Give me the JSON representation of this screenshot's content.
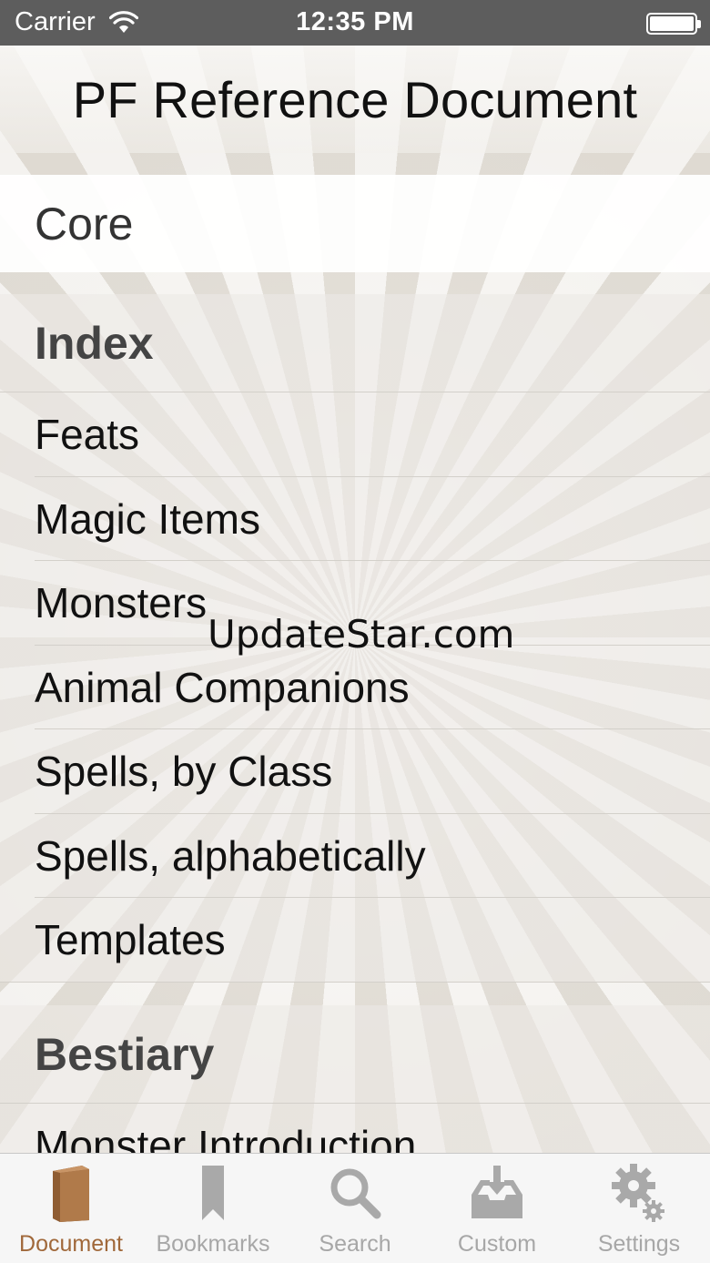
{
  "status_bar": {
    "carrier": "Carrier",
    "time": "12:35 PM"
  },
  "nav": {
    "title": "PF Reference Document"
  },
  "core": {
    "label": "Core"
  },
  "sections": [
    {
      "header": "Index",
      "items": [
        "Feats",
        "Magic Items",
        "Monsters",
        "Animal Companions",
        "Spells, by Class",
        "Spells, alphabetically",
        "Templates"
      ]
    },
    {
      "header": "Bestiary",
      "items": [
        "Monster Introduction"
      ]
    }
  ],
  "watermark": "UpdateStar.com",
  "tabs": [
    {
      "label": "Document",
      "icon": "book-icon",
      "active": true
    },
    {
      "label": "Bookmarks",
      "icon": "bookmark-icon",
      "active": false
    },
    {
      "label": "Search",
      "icon": "search-icon",
      "active": false
    },
    {
      "label": "Custom",
      "icon": "download-tray-icon",
      "active": false
    },
    {
      "label": "Settings",
      "icon": "gear-icon",
      "active": false
    }
  ],
  "colors": {
    "accent": "#a0683a",
    "inactive": "#a7a7a7",
    "status_bar": "#5d5d5d"
  }
}
